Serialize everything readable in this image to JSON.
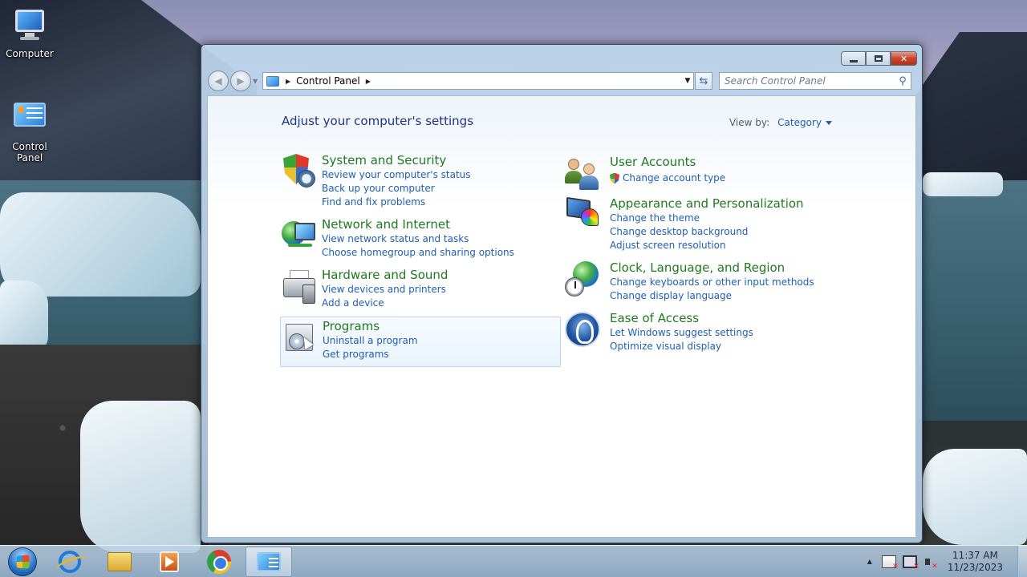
{
  "desktop": {
    "icons": [
      {
        "label": "Computer"
      },
      {
        "label": "Control\nPanel"
      }
    ]
  },
  "window": {
    "address": {
      "crumb": "Control Panel"
    },
    "search": {
      "placeholder": "Search Control Panel"
    },
    "page_title": "Adjust your computer's settings",
    "view_by": {
      "label": "View by:",
      "value": "Category"
    },
    "categories_left": [
      {
        "heading": "System and Security",
        "links": [
          "Review your computer's status",
          "Back up your computer",
          "Find and fix problems"
        ]
      },
      {
        "heading": "Network and Internet",
        "links": [
          "View network status and tasks",
          "Choose homegroup and sharing options"
        ]
      },
      {
        "heading": "Hardware and Sound",
        "links": [
          "View devices and printers",
          "Add a device"
        ]
      },
      {
        "heading": "Programs",
        "links": [
          "Uninstall a program",
          "Get programs"
        ]
      }
    ],
    "categories_right": [
      {
        "heading": "User Accounts",
        "links": [
          "Change account type"
        ]
      },
      {
        "heading": "Appearance and Personalization",
        "links": [
          "Change the theme",
          "Change desktop background",
          "Adjust screen resolution"
        ]
      },
      {
        "heading": "Clock, Language, and Region",
        "links": [
          "Change keyboards or other input methods",
          "Change display language"
        ]
      },
      {
        "heading": "Ease of Access",
        "links": [
          "Let Windows suggest settings",
          "Optimize visual display"
        ]
      }
    ]
  },
  "taskbar": {
    "items": [
      "start-button",
      "internet-explorer",
      "windows-explorer",
      "media-player",
      "chrome",
      "control-panel"
    ],
    "active_item": "control-panel",
    "clock": {
      "time": "11:37 AM",
      "date": "11/23/2023"
    }
  }
}
